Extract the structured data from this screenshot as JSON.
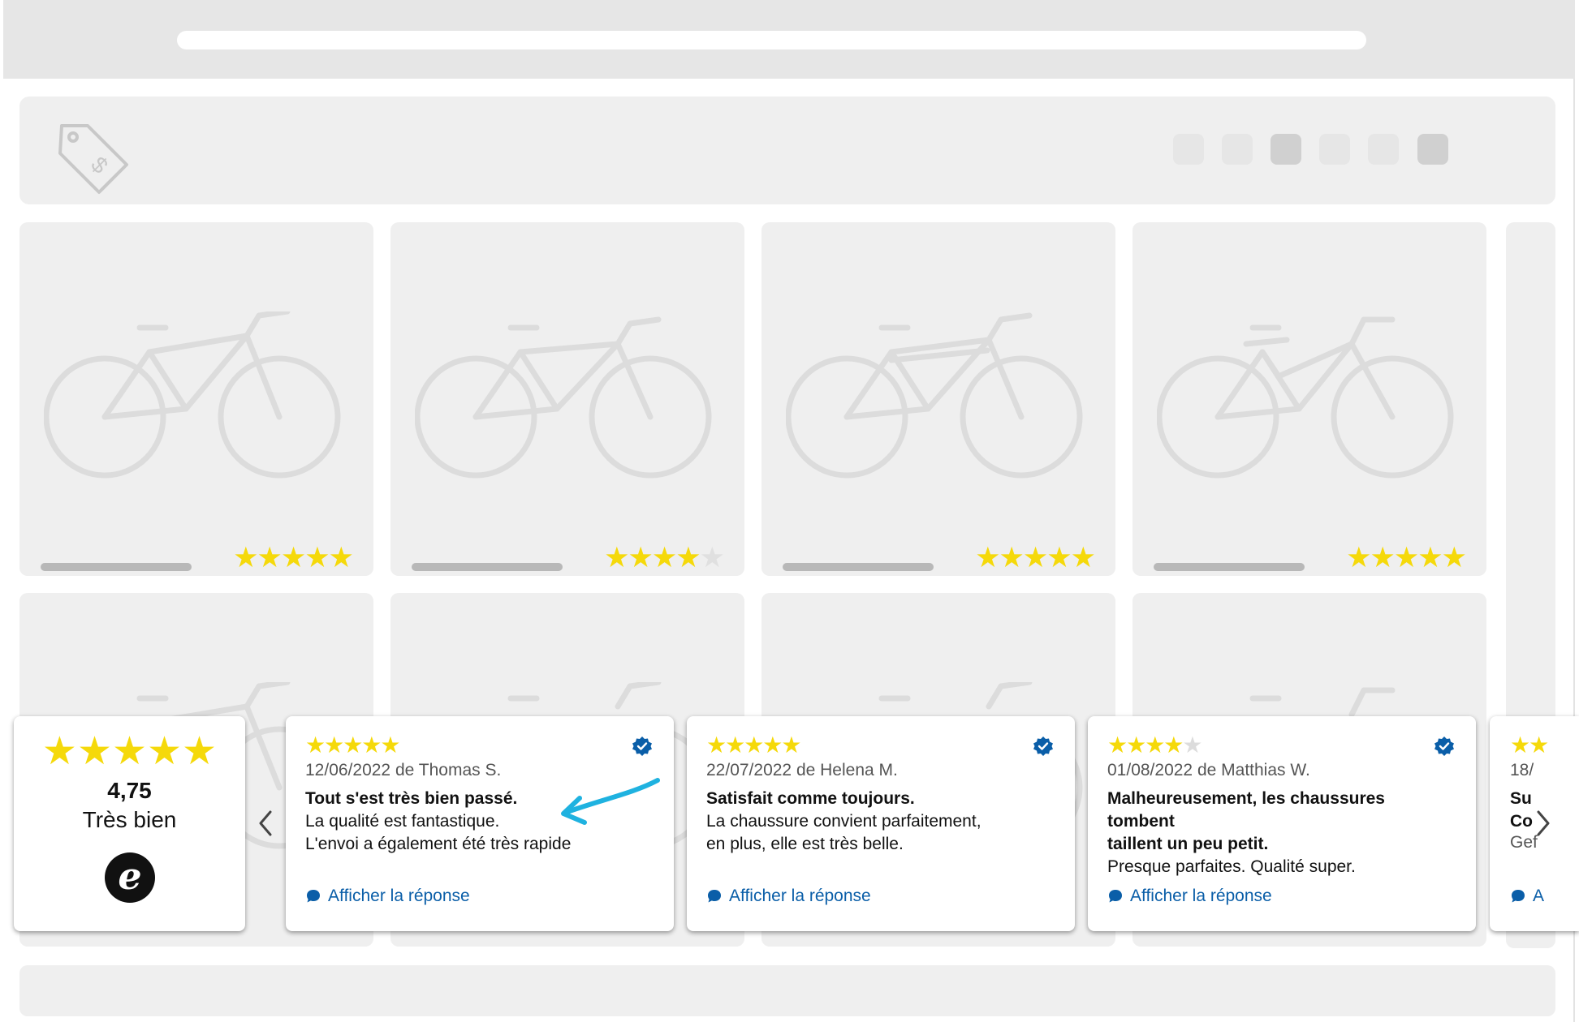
{
  "product_cards": [
    {
      "rating": 5
    },
    {
      "rating": 4
    },
    {
      "rating": 5
    },
    {
      "rating": 5
    }
  ],
  "header": {
    "logo_icon": "price-tag-icon",
    "pagination": [
      {
        "state": "light"
      },
      {
        "state": "light"
      },
      {
        "state": "dark"
      },
      {
        "state": "light"
      },
      {
        "state": "light"
      },
      {
        "state": "dark"
      }
    ]
  },
  "summary": {
    "stars": "★★★★★",
    "score": "4,75",
    "label": "Très bien",
    "logo_letter": "e"
  },
  "reviews": [
    {
      "stars_on": "★★★★★",
      "stars_off": "",
      "date": "12/06/2022",
      "sep": " de ",
      "author": "Thomas S.",
      "title": "Tout s'est très bien passé.",
      "text_lines": [
        "La qualité est fantastique.",
        "L'envoi a également été très rapide"
      ],
      "reply_label": "Afficher la réponse"
    },
    {
      "stars_on": "★★★★★",
      "stars_off": "",
      "date": "22/07/2022",
      "sep": " de ",
      "author": "Helena M.",
      "title": "Satisfait comme toujours.",
      "text_lines": [
        "La chaussure convient parfaitement,",
        "en plus, elle est très belle."
      ],
      "reply_label": "Afficher la réponse"
    },
    {
      "stars_on": "★★★★",
      "stars_off": "★",
      "date": "01/08/2022",
      "sep": " de ",
      "author": "Matthias W.",
      "title_lines": [
        "Malheureusement, les chaussures",
        "tombent",
        "taillent un peu petit."
      ],
      "text_lines": [
        "Presque parfaites. Qualité super."
      ],
      "reply_label": "Afficher la réponse"
    }
  ],
  "peek_review": {
    "stars": "★★",
    "meta": "18/",
    "title_lines": [
      "Su",
      "Co"
    ],
    "text": "Gef",
    "reply_label": "A"
  },
  "colors": {
    "star": "#f5d90a",
    "link": "#0a5ea8",
    "verified": "#0a5ea8",
    "annotation": "#1fb2e0"
  }
}
